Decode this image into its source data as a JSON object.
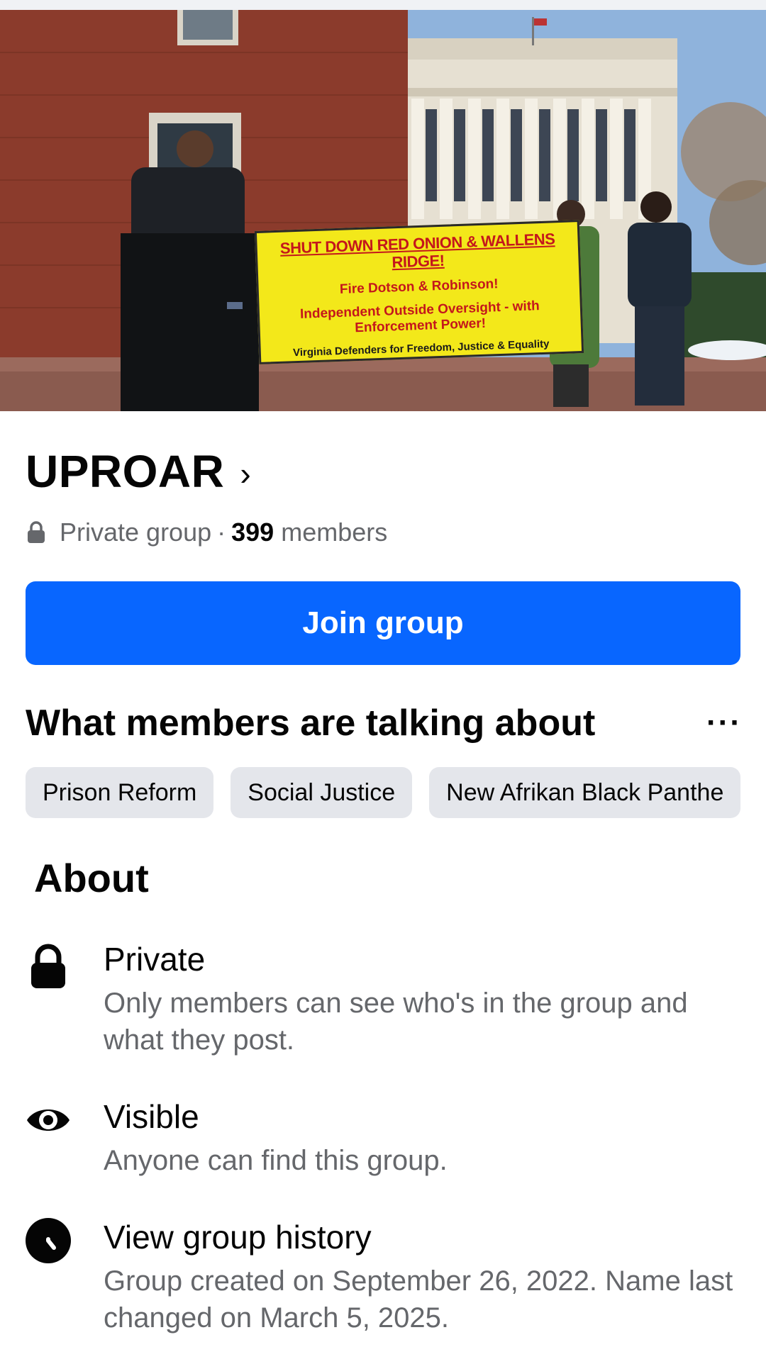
{
  "cover": {
    "banner_line1": "SHUT DOWN RED ONION & WALLENS RIDGE!",
    "banner_line2": "Fire Dotson & Robinson!",
    "banner_line3": "Independent Outside Oversight - with Enforcement Power!",
    "banner_line4": "Virginia Defenders for Freedom, Justice & Equality"
  },
  "group": {
    "name": "UPROAR",
    "privacy_label": "Private group",
    "separator": "·",
    "member_count": "399",
    "members_label": "members"
  },
  "join_button": {
    "label": "Join group",
    "color": "#0866ff"
  },
  "talking": {
    "title": "What members are talking about",
    "more_icon": "···",
    "chips": [
      "Prison Reform",
      "Social Justice",
      "New Afrikan Black Panthe"
    ]
  },
  "about": {
    "title": "About",
    "items": [
      {
        "icon": "lock-icon",
        "title": "Private",
        "description": "Only members can see who's in the group and what they post."
      },
      {
        "icon": "eye-icon",
        "title": "Visible",
        "description": "Anyone can find this group."
      },
      {
        "icon": "clock-icon",
        "title": "View group history",
        "description": "Group created on September 26, 2022. Name last changed on March 5, 2025."
      }
    ]
  },
  "colors": {
    "accent": "#0866ff",
    "secondary_text": "#65676b",
    "chip_bg": "#e4e6eb",
    "banner_yellow": "#f3e81a",
    "banner_red": "#c4171c"
  }
}
